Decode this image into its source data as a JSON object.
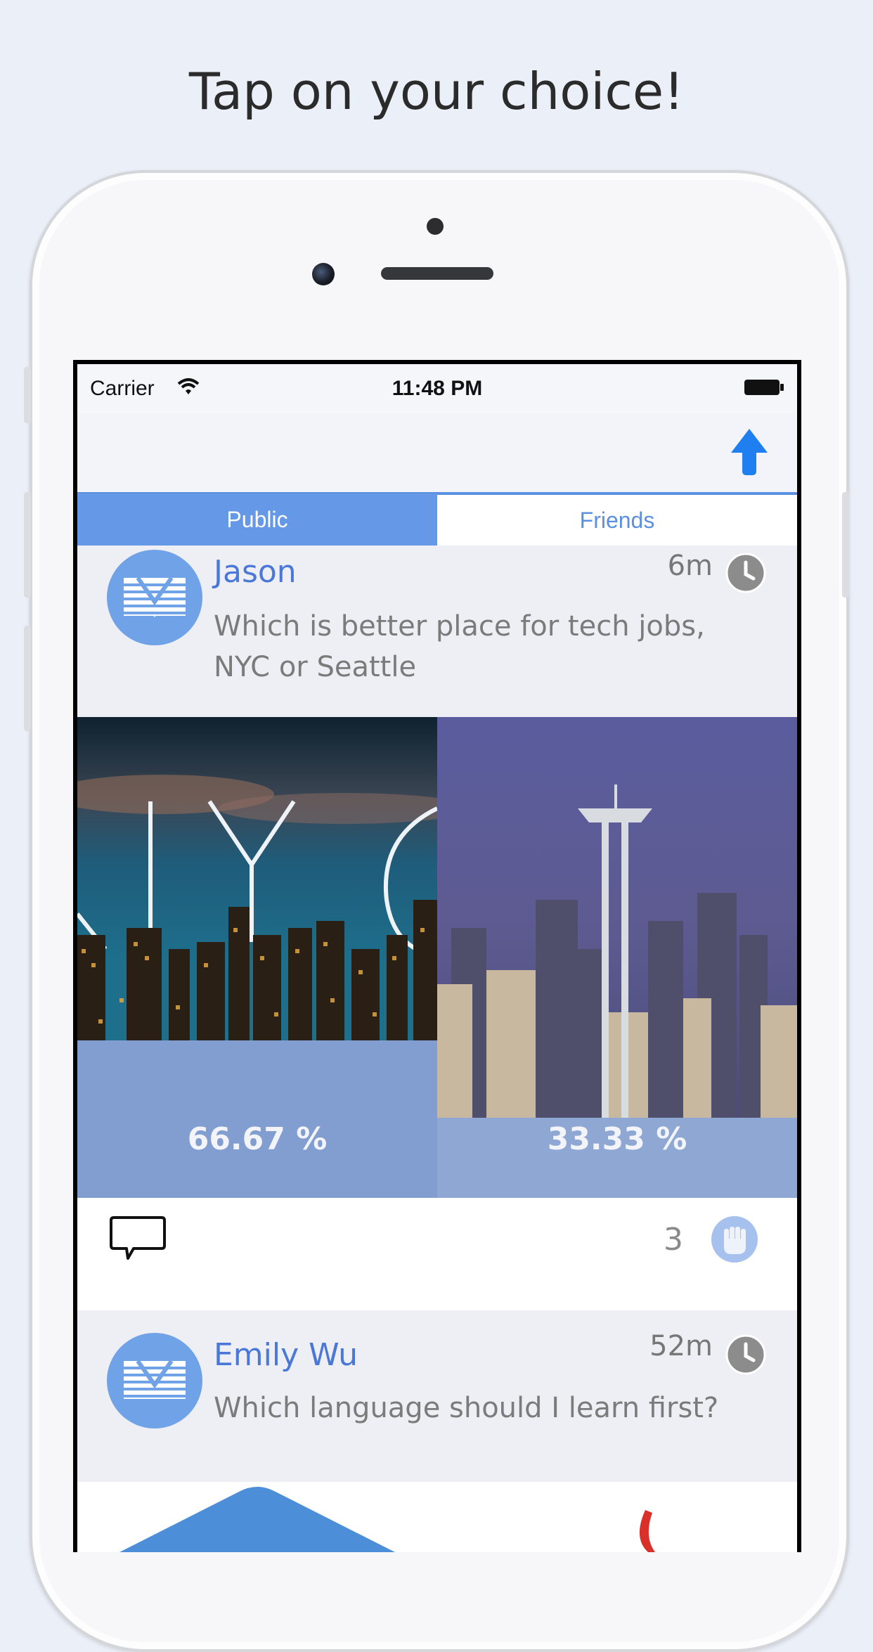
{
  "headline": "Tap on your choice!",
  "status": {
    "carrier": "Carrier",
    "time": "11:48 PM"
  },
  "nav": {
    "upload_icon": "arrow-up-icon"
  },
  "tabs": [
    {
      "label": "Public",
      "active": true
    },
    {
      "label": "Friends",
      "active": false
    }
  ],
  "posts": [
    {
      "user": "Jason",
      "time": "6m",
      "question_line1": "Which is better place for tech jobs,",
      "question_line2": "NYC or Seattle",
      "choices": [
        {
          "name": "NYC",
          "image": "NYC skyline at dusk",
          "percent": "66.67 %"
        },
        {
          "name": "Seattle",
          "image": "Seattle Space Needle skyline",
          "percent": "33.33 %"
        }
      ],
      "vote_count": "3"
    },
    {
      "user": "Emily Wu",
      "time": "52m",
      "question_line1": "Which language should I learn first?"
    }
  ],
  "colors": {
    "accent": "#6599e8",
    "username": "#4a78d8",
    "background": "#ebeff8"
  }
}
